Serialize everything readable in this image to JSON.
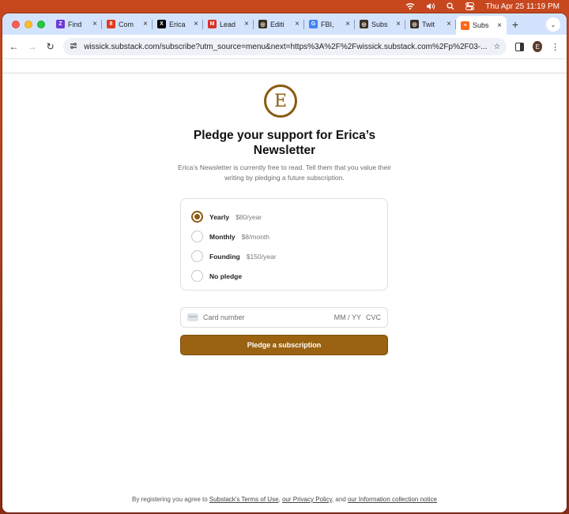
{
  "menubar": {
    "date_time": "Thu Apr 25  11:19 PM"
  },
  "tabs": [
    {
      "label": "Find",
      "icon": "zapier-icon",
      "color": "#6d3bd3",
      "glyph": "Z"
    },
    {
      "label": "Com",
      "icon": "substack-icon",
      "color": "#e03a1f",
      "glyph": "8"
    },
    {
      "label": "Erica",
      "icon": "x-icon",
      "color": "#000000",
      "glyph": "X"
    },
    {
      "label": "Lead",
      "icon": "gmail-icon",
      "color": "#d93025",
      "glyph": "M"
    },
    {
      "label": "Editi",
      "icon": "newsletter-icon",
      "color": "#3b3122",
      "glyph": "◎"
    },
    {
      "label": "FBI,",
      "icon": "google-icon",
      "color": "#4285f4",
      "glyph": "G"
    },
    {
      "label": "Subs",
      "icon": "newsletter-icon",
      "color": "#3b3122",
      "glyph": "◎"
    },
    {
      "label": "Twit",
      "icon": "newsletter-icon",
      "color": "#3b3122",
      "glyph": "◎"
    },
    {
      "label": "Subs",
      "icon": "substack-icon",
      "color": "#ff6719",
      "glyph": "≡",
      "active": true
    }
  ],
  "toolbar": {
    "url": "wissick.substack.com/subscribe?utm_source=menu&next=https%3A%2F%2Fwissick.substack.com%2Fp%2F03-...",
    "profile_initial": "E"
  },
  "page": {
    "logo_letter": "E",
    "title": "Pledge your support for Erica’s Newsletter",
    "subtitle": "Erica’s Newsletter is currently free to read. Tell them that you value their writing by pledging a future subscription.",
    "plans": [
      {
        "name": "Yearly",
        "price": "$80/year",
        "selected": true
      },
      {
        "name": "Monthly",
        "price": "$8/month",
        "selected": false
      },
      {
        "name": "Founding",
        "price": "$150/year",
        "selected": false
      },
      {
        "name": "No pledge",
        "price": "",
        "selected": false
      }
    ],
    "card": {
      "placeholder": "Card number",
      "expiry": "MM / YY",
      "cvc": "CVC"
    },
    "cta_label": "Pledge a subscription",
    "footer": {
      "prefix": "By registering you agree to ",
      "terms": "Substack's Terms of Use",
      "sep1": ", ",
      "privacy": "our Privacy Policy",
      "sep2": ", and ",
      "notice": "our Information collection notice"
    }
  },
  "colors": {
    "accent": "#9a6211"
  }
}
